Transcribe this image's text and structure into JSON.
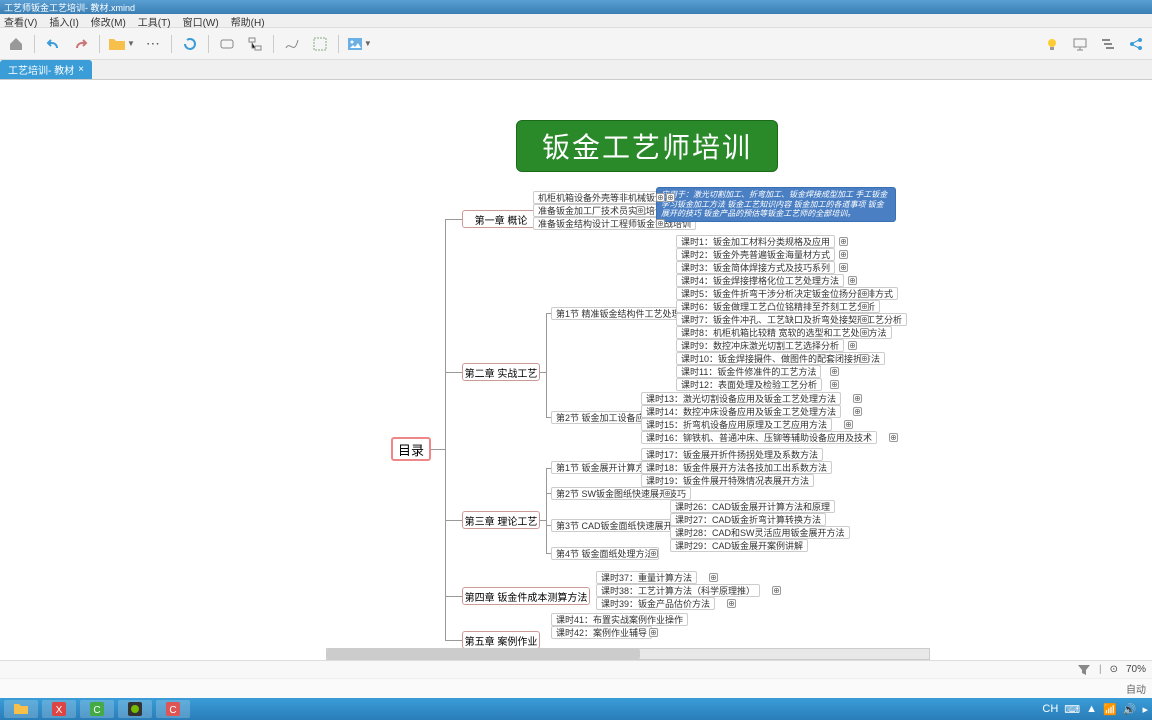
{
  "window_title": "工艺师钣金工艺培训- 教材.xmind",
  "menu": [
    "查看(V)",
    "插入(I)",
    "修改(M)",
    "工具(T)",
    "窗口(W)",
    "帮助(H)"
  ],
  "tab": {
    "label": "工艺培训- 教材",
    "close": "×"
  },
  "status": {
    "zoom": "70%",
    "lower": "自动"
  },
  "title_node": "钣金工艺师培训",
  "root": "目录",
  "chapters": {
    "c1": "第一章 概论",
    "c2": "第二章 实战工艺",
    "c3": "第三章 理论工艺",
    "c4": "第四章 钣金件成本测算方法",
    "c5": "第五章 案例作业"
  },
  "c1_items": [
    "机柜机箱设备外壳等非机械钣金加工行业",
    "准备钣金加工厂技术员实战培训",
    "准备钣金结构设计工程师钣金实战培训"
  ],
  "note": "应用于：激光切割加工、折弯加工、钣金焊接成型加工 手工钣金 学习钣金加工方法 钣金工艺知识内容 钣金加工的各道事项 钣金展开的技巧 钣金产品的预估等钣金工艺师的全部培训。",
  "c2_s1": "第1节 精准钣金结构件工艺处理方法",
  "c2_s1_items": [
    "课时1：钣金加工材料分类规格及应用",
    "课时2：钣金外壳普遍钣金海量材方式",
    "课时3：钣金简体焊接方式及技巧系列",
    "课时4：钣金焊接撑格化位工艺处理方法",
    "课时5：钣金件折弯干涉分析决定钣金位扬分部排方式",
    "课时6：钣金做理工艺凸位铭精排至芥刻工艺分析",
    "课时7：钣金件冲孔、工艺缺口及折弯处接契形工艺分析",
    "课时8：机柜机箱比较精 宽软的选型和工艺处理方法",
    "课时9：数控冲床激光切割工艺选择分析",
    "课时10：钣金焊接摄件、做图件的配套闭接折方法",
    "课时11：钣金件修准件的工艺方法",
    "课时12：表面处理及检验工艺分析"
  ],
  "c2_s2": "第2节 钣金加工设备应用",
  "c2_s2_items": [
    "课时13：激光切割设备应用及钣金工艺处理方法",
    "课时14：数控冲床设备应用及钣金工艺处理方法",
    "课时15：折弯机设备应用原理及工艺应用方法",
    "课时16：铆铁机、普通冲床、压铆等辅助设备应用及技术"
  ],
  "c3_s1": "第1节 钣金展开计算方法",
  "c3_s1_items": [
    "课时17：钣金展开折件扬拐处理及系数方法",
    "课时18：钣金件展开方法各技加工出系数方法",
    "课时19：钣金件展开特殊情况表展开方法"
  ],
  "c3_s2": "第2节 SW钣金图纸快速展开技巧",
  "c3_s3": "第3节 CAD钣金面纸快速展开技巧",
  "c3_s3_items": [
    "课时26：CAD钣金展开计算方法和原理",
    "课时27：CAD钣金折弯计算转换方法",
    "课时28：CAD和SW灵活应用钣金展开方法",
    "课时29：CAD钣金展开案例讲解"
  ],
  "c3_s4": "第4节 钣金面纸处理方法",
  "c4_items": [
    "课时37：重量计算方法",
    "课时38：工艺计算方法（科学原理推）",
    "课时39：钣金产品估价方法"
  ],
  "c5_items": [
    "课时41：布置实战案例作业操作",
    "课时42：案例作业辅导"
  ]
}
